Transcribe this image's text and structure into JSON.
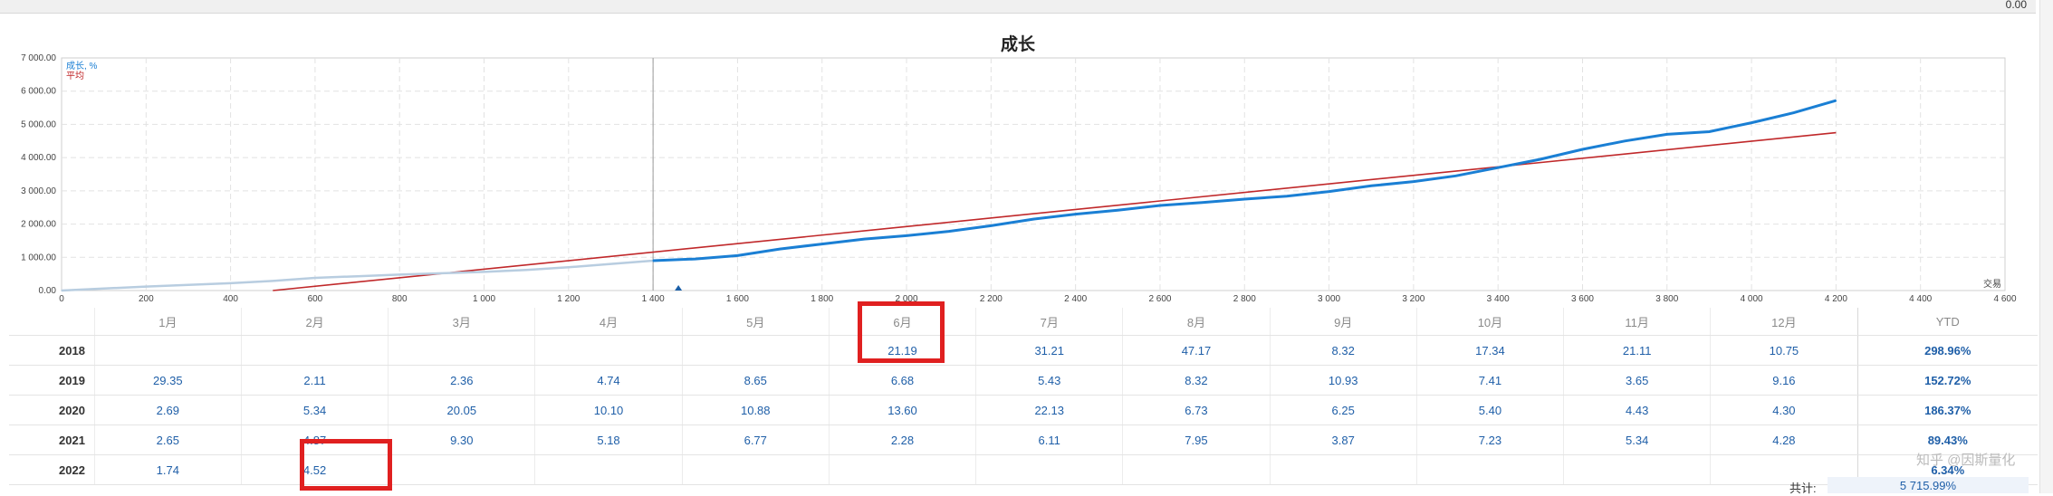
{
  "topbar": {
    "value": "0.00"
  },
  "watermark": "知乎 @因斯量化",
  "chart_data": {
    "type": "line",
    "title": "成长",
    "xlabel": "交易",
    "ylabel": "",
    "xlim": [
      0,
      4600
    ],
    "ylim": [
      0,
      7000
    ],
    "x_ticks": [
      0,
      200,
      400,
      600,
      800,
      1000,
      1200,
      1400,
      1600,
      1800,
      2000,
      2200,
      2400,
      2600,
      2800,
      3000,
      3200,
      3400,
      3600,
      3800,
      4000,
      4200,
      4400,
      4600
    ],
    "x_tick_labels": [
      "0",
      "200",
      "400",
      "600",
      "800",
      "1 000",
      "1 200",
      "1 400",
      "1 600",
      "1 800",
      "2 000",
      "2 200",
      "2 400",
      "2 600",
      "2 800",
      "3 000",
      "3 200",
      "3 400",
      "3 600",
      "3 800",
      "4 000",
      "4 200",
      "4 400",
      "4 600"
    ],
    "y_ticks": [
      0,
      1000,
      2000,
      3000,
      4000,
      5000,
      6000,
      7000
    ],
    "y_tick_labels": [
      "0.00",
      "1 000.00",
      "2 000.00",
      "3 000.00",
      "4 000.00",
      "5 000.00",
      "6 000.00",
      "7 000.00"
    ],
    "grid": true,
    "legend_position": "top-left",
    "vertical_marker_x": 1400,
    "marker_triangle_x": 1460,
    "series": [
      {
        "name": "成长, %",
        "color": "#1a7fd4",
        "faded_color": "#b8cde0",
        "faded_until_x": 1400,
        "x": [
          0,
          100,
          200,
          300,
          400,
          500,
          600,
          700,
          800,
          900,
          1000,
          1100,
          1200,
          1300,
          1400,
          1500,
          1600,
          1700,
          1800,
          1900,
          2000,
          2100,
          2200,
          2300,
          2400,
          2500,
          2600,
          2700,
          2800,
          2900,
          3000,
          3100,
          3200,
          3300,
          3400,
          3500,
          3600,
          3700,
          3800,
          3900,
          4000,
          4100,
          4200
        ],
        "values": [
          0,
          60,
          120,
          170,
          220,
          290,
          380,
          430,
          480,
          520,
          560,
          620,
          700,
          800,
          900,
          950,
          1050,
          1250,
          1400,
          1550,
          1650,
          1780,
          1950,
          2150,
          2300,
          2420,
          2560,
          2650,
          2750,
          2840,
          2980,
          3150,
          3280,
          3450,
          3700,
          3950,
          4250,
          4500,
          4700,
          4780,
          5050,
          5350,
          5716
        ]
      },
      {
        "name": "平均",
        "color": "#c0282a",
        "x": [
          500,
          4200
        ],
        "values": [
          0,
          4750
        ]
      }
    ]
  },
  "table": {
    "headers": [
      "",
      "1月",
      "2月",
      "3月",
      "4月",
      "5月",
      "6月",
      "7月",
      "8月",
      "9月",
      "10月",
      "11月",
      "12月",
      "YTD"
    ],
    "rows": [
      {
        "year": "2018",
        "values": [
          "",
          "",
          "",
          "",
          "",
          "21.19",
          "31.21",
          "47.17",
          "8.32",
          "17.34",
          "21.11",
          "10.75"
        ],
        "ytd": "298.96%"
      },
      {
        "year": "2019",
        "values": [
          "29.35",
          "2.11",
          "2.36",
          "4.74",
          "8.65",
          "6.68",
          "5.43",
          "8.32",
          "10.93",
          "7.41",
          "3.65",
          "9.16"
        ],
        "ytd": "152.72%"
      },
      {
        "year": "2020",
        "values": [
          "2.69",
          "5.34",
          "20.05",
          "10.10",
          "10.88",
          "13.60",
          "22.13",
          "6.73",
          "6.25",
          "5.40",
          "4.43",
          "4.30"
        ],
        "ytd": "186.37%"
      },
      {
        "year": "2021",
        "values": [
          "2.65",
          "4.87",
          "9.30",
          "5.18",
          "6.77",
          "2.28",
          "6.11",
          "7.95",
          "3.87",
          "7.23",
          "5.34",
          "4.28"
        ],
        "ytd": "89.43%"
      },
      {
        "year": "2022",
        "values": [
          "1.74",
          "4.52",
          "",
          "",
          "",
          "",
          "",
          "",
          "",
          "",
          "",
          ""
        ],
        "ytd": "6.34%"
      }
    ],
    "total_label": "共计:",
    "total_value": "5 715.99%"
  }
}
